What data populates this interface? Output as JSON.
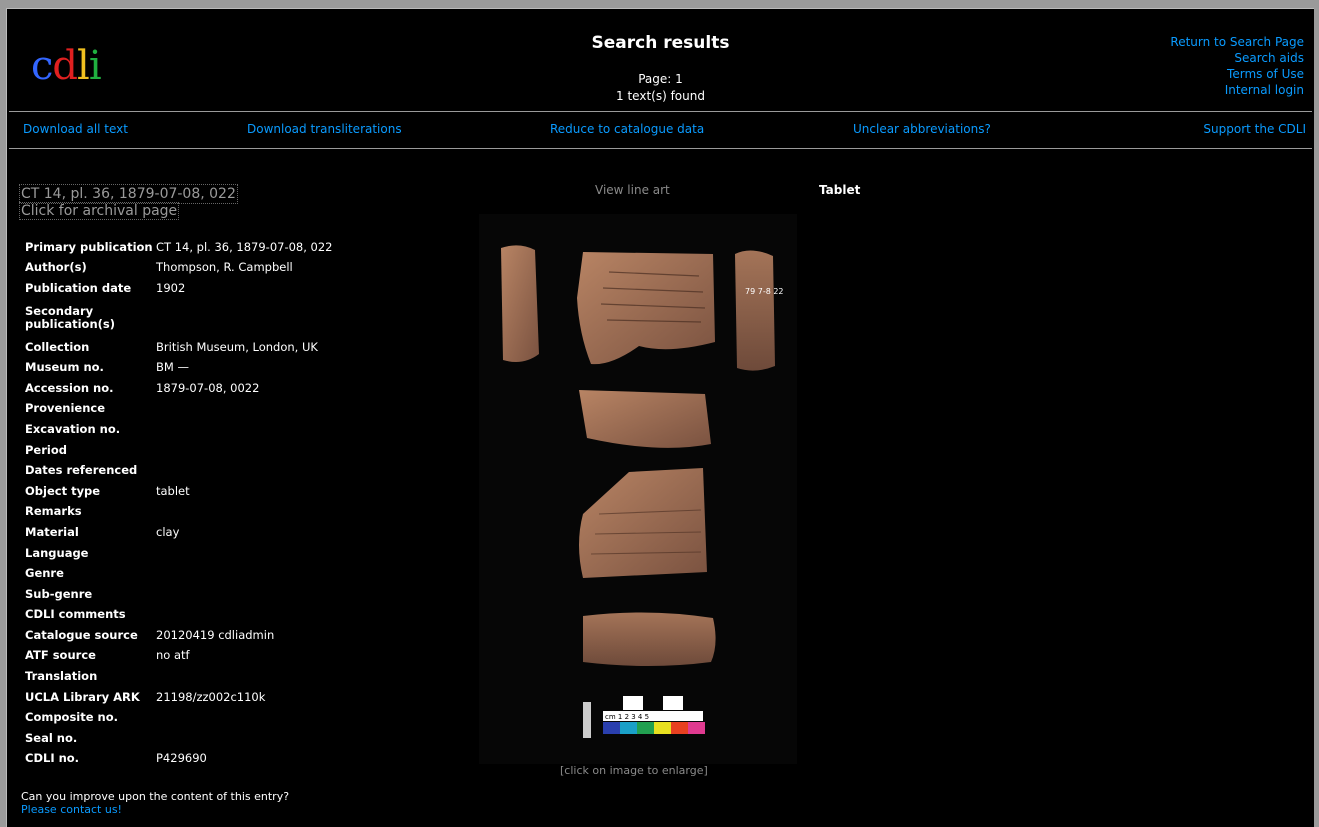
{
  "header": {
    "logo": {
      "c1": "c",
      "d": "d",
      "l": "l",
      "i": "i"
    },
    "title": "Search results",
    "page": "Page: 1",
    "found": "1 text(s) found",
    "links": [
      "Return to Search Page",
      "Search aids",
      "Terms of Use",
      "Internal login"
    ]
  },
  "nav": [
    "Download all text",
    "Download transliterations",
    "Reduce to catalogue data",
    "Unclear abbreviations?",
    "Support the CDLI"
  ],
  "entry": {
    "title": "CT 14, pl. 36, 1879-07-08, 022",
    "archival_link": "Click for archival page",
    "line_art": "View line art",
    "object_heading": "Tablet",
    "enlarge_hint": "[click on image to enlarge]",
    "fields": [
      {
        "key": "Primary publication",
        "value": "CT 14, pl. 36, 1879-07-08, 022"
      },
      {
        "key": "Author(s)",
        "value": "Thompson, R. Campbell"
      },
      {
        "key": "Publication date",
        "value": "1902"
      },
      {
        "key": "Secondary publication(s)",
        "value": ""
      },
      {
        "key": "Collection",
        "value": "British Museum, London, UK"
      },
      {
        "key": "Museum no.",
        "value": "BM —"
      },
      {
        "key": "Accession no.",
        "value": "1879-07-08, 0022"
      },
      {
        "key": "Provenience",
        "value": ""
      },
      {
        "key": "Excavation no.",
        "value": ""
      },
      {
        "key": "Period",
        "value": ""
      },
      {
        "key": "Dates referenced",
        "value": ""
      },
      {
        "key": "Object type",
        "value": "tablet"
      },
      {
        "key": "Remarks",
        "value": ""
      },
      {
        "key": "Material",
        "value": "clay"
      },
      {
        "key": "Language",
        "value": ""
      },
      {
        "key": "Genre",
        "value": ""
      },
      {
        "key": "Sub-genre",
        "value": ""
      },
      {
        "key": "CDLI comments",
        "value": ""
      },
      {
        "key": "Catalogue source",
        "value": "20120419 cdliadmin"
      },
      {
        "key": "ATF source",
        "value": "no atf"
      },
      {
        "key": "Translation",
        "value": ""
      },
      {
        "key": "UCLA Library ARK",
        "value": "21198/zz002c110k"
      },
      {
        "key": "Composite no.",
        "value": ""
      },
      {
        "key": "Seal no.",
        "value": ""
      },
      {
        "key": "CDLI no.",
        "value": "P429690"
      }
    ],
    "tablet_edge_label": "79 7-8 22"
  },
  "footer": {
    "question": "Can you improve upon the content of this entry?",
    "contact": "Please contact us!"
  },
  "scale_bar": {
    "label": "cm 1 2 3 4 5",
    "colors": [
      "#2a3fae",
      "#1aa0c8",
      "#22a050",
      "#e8e020",
      "#e84020",
      "#e03a90"
    ]
  }
}
